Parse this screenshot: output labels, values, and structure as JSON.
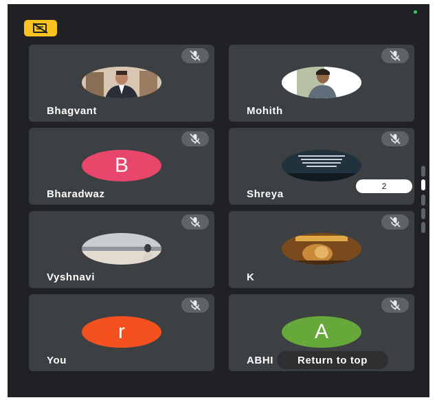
{
  "app": {
    "colors": {
      "background": "#202124",
      "tile": "#3c4043",
      "accent": "#f7c51e"
    }
  },
  "top_icon": {
    "name": "cast-off-icon"
  },
  "participants": [
    {
      "name": "Bhagvant",
      "avatar": "photo",
      "muted": true
    },
    {
      "name": "Mohith",
      "avatar": "photo",
      "muted": true
    },
    {
      "name": "Bharadwaz",
      "avatar": "letter",
      "letter": "B",
      "color": "#e8466b",
      "muted": true
    },
    {
      "name": "Shreya",
      "avatar": "photo",
      "muted": true
    },
    {
      "name": "Vyshnavi",
      "avatar": "photo",
      "muted": true
    },
    {
      "name": "K",
      "avatar": "photo",
      "muted": true
    },
    {
      "name": "You",
      "avatar": "letter",
      "letter": "r",
      "color": "#f4511e",
      "muted": true
    },
    {
      "name": "ABHI",
      "avatar": "letter",
      "letter": "A",
      "color": "#67a83b",
      "muted": true
    }
  ],
  "page_indicator": {
    "value": "2"
  },
  "return_to_top": {
    "label": "Return to top"
  }
}
